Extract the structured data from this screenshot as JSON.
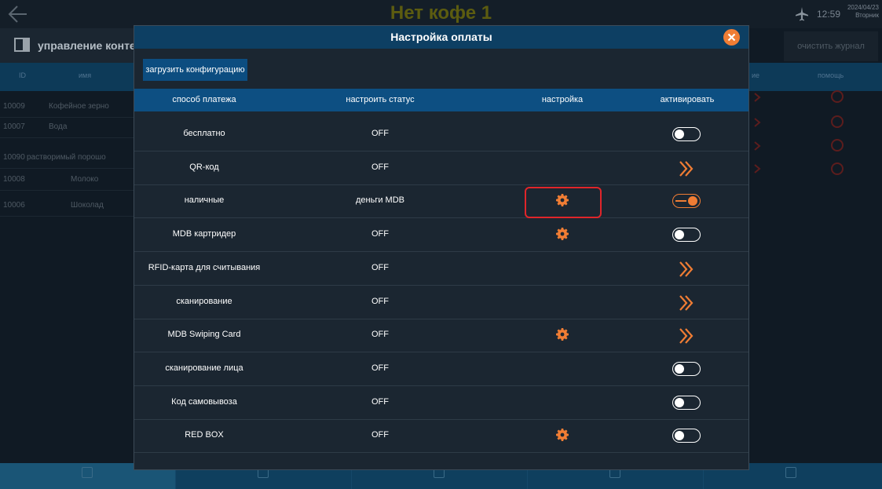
{
  "app": {
    "title": "Нет кофе 1",
    "time": "12:59",
    "date": "2024/04/23",
    "weekday": "Вторник"
  },
  "sidebar": {
    "title": "управление конте",
    "columns": {
      "id": "ID",
      "name": "имя"
    },
    "rows": [
      {
        "id": "10009",
        "name": "Кофейное зерно"
      },
      {
        "id": "10007",
        "name": "Вода"
      },
      {
        "id": "10090",
        "name": "растворимый порошо"
      },
      {
        "id": "10008",
        "name": "Молоко"
      },
      {
        "id": "10006",
        "name": "Шоколад"
      }
    ]
  },
  "right_panel": {
    "clear_log": "очистить журнал",
    "col_partial": "ие",
    "col_help": "помощь"
  },
  "modal": {
    "title": "Настройка оплаты",
    "load_config": "загрузить конфигурацию",
    "columns": {
      "method": "способ платежа",
      "status": "настроить статус",
      "settings": "настройка",
      "activate": "активировать"
    },
    "rows": [
      {
        "method": "бесплатно",
        "status": "OFF",
        "has_gear": false,
        "control": "toggle-off"
      },
      {
        "method": "QR-код",
        "status": "OFF",
        "has_gear": false,
        "control": "chevron"
      },
      {
        "method": "наличные",
        "status": "деньги MDB",
        "has_gear": true,
        "highlighted": true,
        "control": "toggle-on"
      },
      {
        "method": "MDB картридер",
        "status": "OFF",
        "has_gear": true,
        "control": "toggle-off"
      },
      {
        "method": "RFID-карта для считывания",
        "status": "OFF",
        "has_gear": false,
        "control": "chevron"
      },
      {
        "method": "сканирование",
        "status": "OFF",
        "has_gear": false,
        "control": "chevron"
      },
      {
        "method": "MDB Swiping Card",
        "status": "OFF",
        "has_gear": true,
        "control": "chevron"
      },
      {
        "method": "сканирование лица",
        "status": "OFF",
        "has_gear": false,
        "control": "toggle-off"
      },
      {
        "method": "Код самовывоза",
        "status": "OFF",
        "has_gear": false,
        "control": "toggle-off"
      },
      {
        "method": "RED BOX",
        "status": "OFF",
        "has_gear": true,
        "control": "toggle-off"
      }
    ]
  },
  "colors": {
    "accent": "#f07d34",
    "header_blue": "#0d4f82",
    "modal_bg": "#1b2631",
    "highlight_red": "#e0252a"
  },
  "icons": {
    "back": "arrow-left-icon",
    "plane": "airplane-icon",
    "close": "close-icon",
    "settings": "gear-icon",
    "navigate": "double-chevron-right-icon"
  }
}
